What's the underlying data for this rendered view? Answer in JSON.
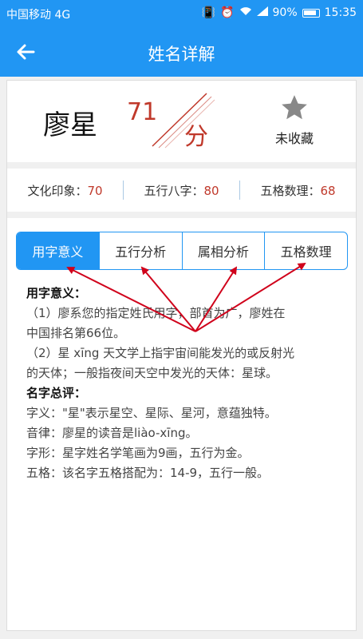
{
  "status_bar": {
    "carrier": "中国移动 4G",
    "battery": "90%",
    "time": "15:35"
  },
  "app_bar": {
    "title": "姓名详解"
  },
  "name_card": {
    "name": "廖星",
    "score": "71",
    "score_unit": "分",
    "favorite_label": "未收藏"
  },
  "stats": [
    {
      "label": "文化印象：",
      "value": "70"
    },
    {
      "label": "五行八字：",
      "value": "80"
    },
    {
      "label": "五格数理：",
      "value": "68"
    }
  ],
  "tabs": [
    {
      "label": "用字意义",
      "active": true
    },
    {
      "label": "五行分析",
      "active": false
    },
    {
      "label": "属相分析",
      "active": false
    },
    {
      "label": "五格数理",
      "active": false
    }
  ],
  "content": {
    "section1_title": "用字意义：",
    "p1_line1": "（1）廖系您的指定姓氏用字，部首为广，廖姓在",
    "p1_line2": "中国排名第66位。",
    "p2_line1": "（2）星 xīng 天文学上指宇宙间能发光的或反射光",
    "p2_line2": "的天体；一般指夜间天空中发光的天体：星球。",
    "section2_title": "名字总评：",
    "meaning": "字义：\"星\"表示星空、星际、星河，意蕴独特。",
    "sound": "音律：廖星的读音是liào-xīng。",
    "form": "字形：星字姓名学笔画为9画，五行为金。",
    "wuge": "五格：该名字五格搭配为：14-9，五行一般。"
  },
  "colors": {
    "primary": "#2196f3",
    "score_red": "#c0392b",
    "arrow_red": "#d0021b"
  }
}
